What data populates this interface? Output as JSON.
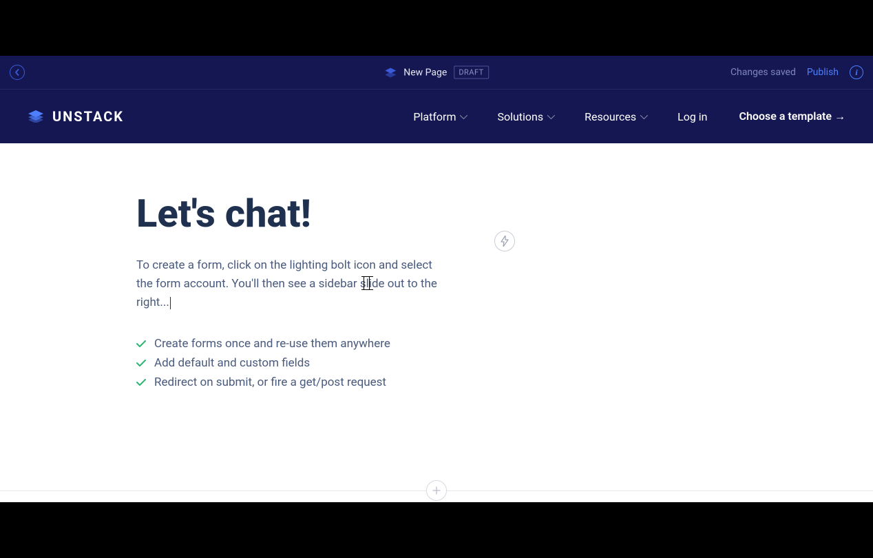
{
  "editor": {
    "page_name": "New Page",
    "status_badge": "DRAFT",
    "save_status": "Changes saved",
    "publish_label": "Publish"
  },
  "nav": {
    "brand": "UNSTACK",
    "items": [
      {
        "label": "Platform",
        "has_dropdown": true
      },
      {
        "label": "Solutions",
        "has_dropdown": true
      },
      {
        "label": "Resources",
        "has_dropdown": true
      },
      {
        "label": "Log in",
        "has_dropdown": false
      }
    ],
    "cta": "Choose a template →"
  },
  "content": {
    "heading": "Let's chat!",
    "paragraph": "To create a form, click on the lighting bolt icon and select the form account. You'll then see a sidebar slide out to the right...",
    "features": [
      "Create forms once and re-use them anywhere",
      "Add default and custom fields",
      "Redirect on submit, or fire a get/post request"
    ]
  }
}
